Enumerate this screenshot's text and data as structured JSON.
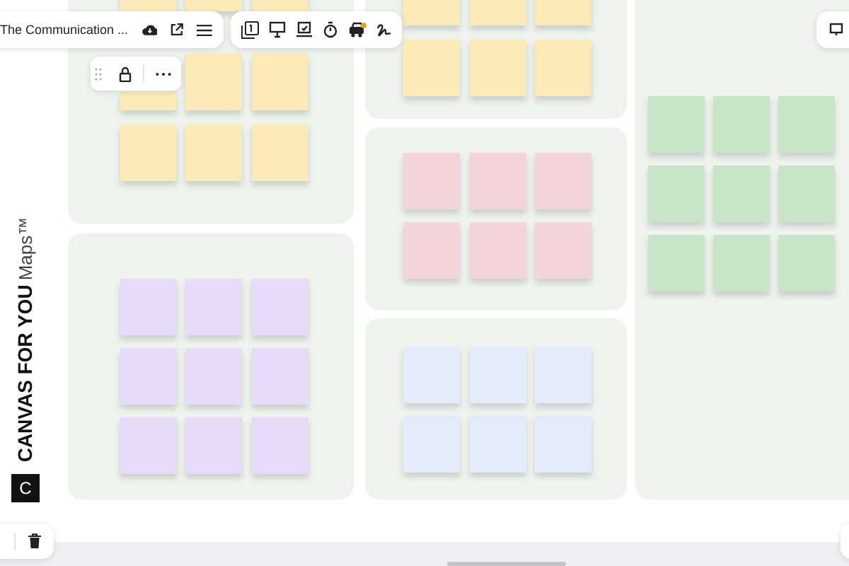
{
  "board_toolbar": {
    "title": "The Communication ..."
  },
  "brand": {
    "name": "CANVAS FOR YOU",
    "suffix": "Maps™",
    "logo": "C"
  },
  "frames": [
    {
      "color": "#fbeab8"
    },
    {
      "color": "#fbeab8"
    },
    {
      "color": "#f4d6da"
    },
    {
      "color": "#e6dcfa"
    },
    {
      "color": "#e4ecfb"
    },
    {
      "color": "#c8e5c8"
    }
  ]
}
